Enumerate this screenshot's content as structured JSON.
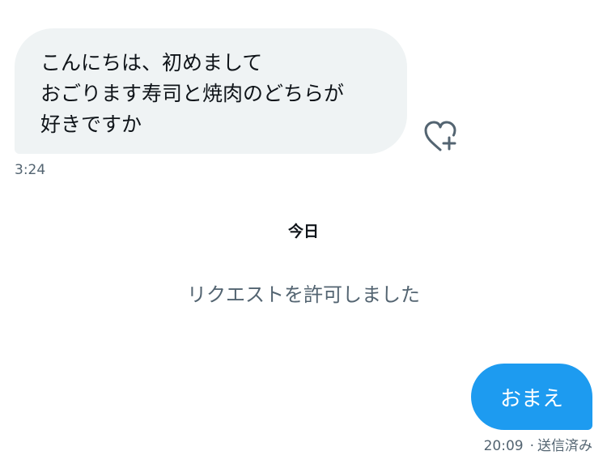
{
  "conversation": {
    "incoming_message": {
      "lines": [
        "こんにちは、初めまして",
        "おごります寿司と焼肉のどちらが",
        "好きですか"
      ],
      "time": "3:24",
      "react_icon": "heart-plus-icon"
    },
    "date_divider": "今日",
    "system_message": "リクエストを許可しました",
    "outgoing_message": {
      "text": "おまえ",
      "time": "20:09",
      "separator": "·",
      "status": "送信済み"
    }
  },
  "colors": {
    "incoming_bubble": "#eff3f4",
    "outgoing_bubble": "#1d9bf0",
    "primary_text": "#0f1419",
    "secondary_text": "#536471"
  }
}
